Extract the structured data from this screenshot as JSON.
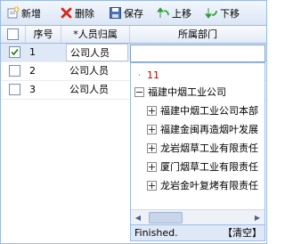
{
  "toolbar": {
    "add_label": "新增",
    "delete_label": "删除",
    "save_label": "保存",
    "up_label": "上移",
    "down_label": "下移"
  },
  "grid": {
    "columns": [
      "序号",
      "*人员归属",
      "所属部门"
    ],
    "rows": [
      {
        "no": "1",
        "type": "公司人员",
        "dept": "",
        "checked": true
      },
      {
        "no": "2",
        "type": "公司人员",
        "dept": "",
        "checked": false
      },
      {
        "no": "3",
        "type": "公司人员",
        "dept": "",
        "checked": false
      }
    ]
  },
  "tree": {
    "root": "11",
    "company": "福建中烟工业公司",
    "children": [
      "福建中烟工业公司本部",
      "福建金闽再造烟叶发展",
      "龙岩烟草工业有限责任",
      "厦门烟草工业有限责任",
      "龙岩金叶复烤有限责任"
    ]
  },
  "status": {
    "text": "Finished.",
    "clear_label": "【清空】"
  },
  "colors": {
    "root_text": "#c00000",
    "border": "#99bbe8",
    "selected_row": "#dfe8f6"
  }
}
